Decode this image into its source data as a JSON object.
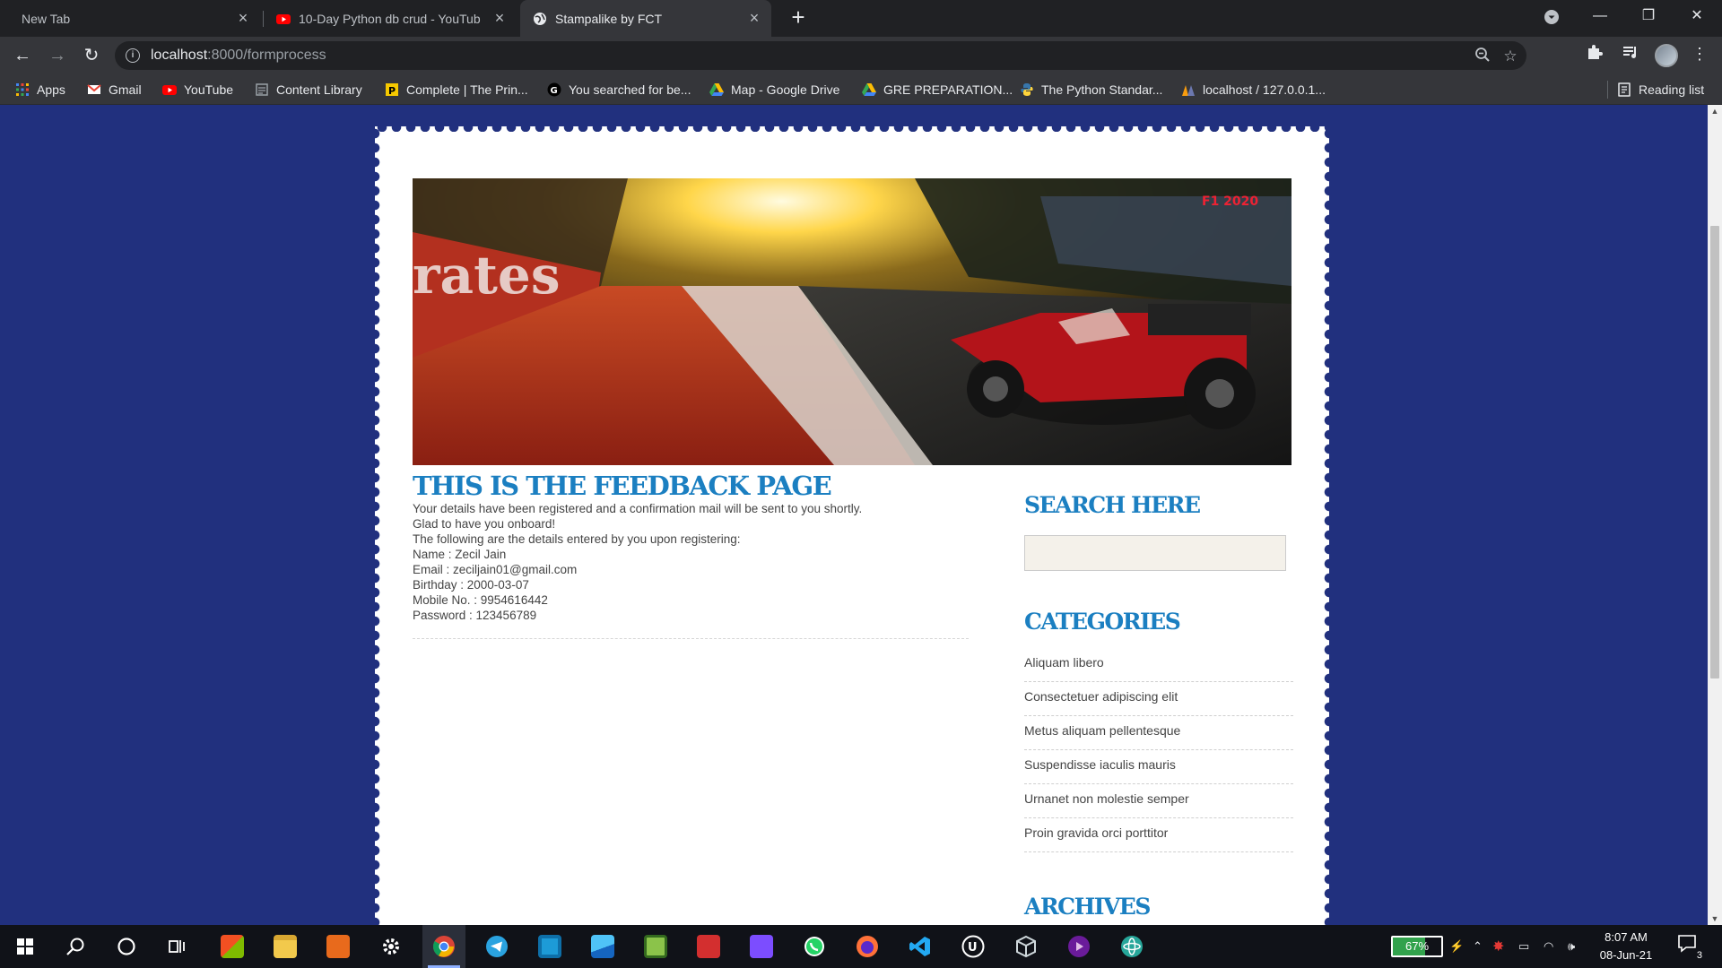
{
  "browser": {
    "tabs": [
      {
        "title": "New Tab",
        "active": false
      },
      {
        "title": "10-Day Python db crud - YouTub",
        "active": false
      },
      {
        "title": "Stampalike by FCT",
        "active": true
      }
    ],
    "url_host": "localhost",
    "url_path": ":8000/formprocess",
    "bookmarks": [
      {
        "label": "Apps",
        "icon": "apps-grid-icon",
        "color": "#4285f4"
      },
      {
        "label": "Gmail",
        "icon": "gmail-icon",
        "color": "#ea4335"
      },
      {
        "label": "YouTube",
        "icon": "youtube-icon",
        "color": "#ff0000"
      },
      {
        "label": "Content Library",
        "icon": "content-library-icon",
        "color": "#9aa0a6"
      },
      {
        "label": "Complete | The Prin...",
        "icon": "book-icon",
        "color": "#f6c900"
      },
      {
        "label": "You searched for be...",
        "icon": "g-icon",
        "color": "#e8eaed"
      },
      {
        "label": "Map - Google Drive",
        "icon": "google-drive-icon",
        "color": "#34a853"
      },
      {
        "label": "GRE PREPARATION...",
        "icon": "google-drive-icon",
        "color": "#fbbc04"
      },
      {
        "label": "The Python Standar...",
        "icon": "python-icon",
        "color": "#3776ab"
      },
      {
        "label": "localhost / 127.0.0.1...",
        "icon": "phpmyadmin-icon",
        "color": "#f89c0e"
      }
    ],
    "reading_list": "Reading list"
  },
  "page": {
    "background": "#21307e",
    "title": "THIS IS THE FEEDBACK PAGE",
    "feedback_lines": [
      "Your details have been registered and a confirmation mail will be sent to you shortly.",
      "Glad to have you onboard!",
      "The following are the details entered by you upon registering:",
      "Name : Zecil Jain",
      "Email : zeciljain01@gmail.com",
      "Birthday : 2000-03-07",
      "Mobile No. : 9954616442",
      "Password : 123456789"
    ],
    "sidebar": {
      "search_heading": "SEARCH HERE",
      "search_value": "",
      "categories_heading": "CATEGORIES",
      "categories": [
        "Aliquam libero",
        "Consectetuer adipiscing elit",
        "Metus aliquam pellentesque",
        "Suspendisse iaculis mauris",
        "Urnanet non molestie semper",
        "Proin gravida orci porttitor"
      ],
      "archives_heading": "ARCHIVES"
    },
    "banner_text": "rates",
    "banner_logo": "F1 2020"
  },
  "taskbar": {
    "apps": [
      "windows-start-icon",
      "search-icon",
      "cortana-icon",
      "task-view-icon",
      "store-icon",
      "file-explorer-icon",
      "orange-app-icon",
      "settings-icon",
      "chrome-icon",
      "telegram-icon",
      "blue-app-icon",
      "photos-icon",
      "excel-sheet-icon",
      "acrobat-icon",
      "visual-studio-icon",
      "whatsapp-icon",
      "firefox-icon",
      "vscode-icon",
      "unreal-icon",
      "box-3d-icon",
      "podcast-icon",
      "atom-icon"
    ],
    "battery": "67%",
    "time": "8:07 AM",
    "date": "08-Jun-21",
    "notifications": "3"
  }
}
